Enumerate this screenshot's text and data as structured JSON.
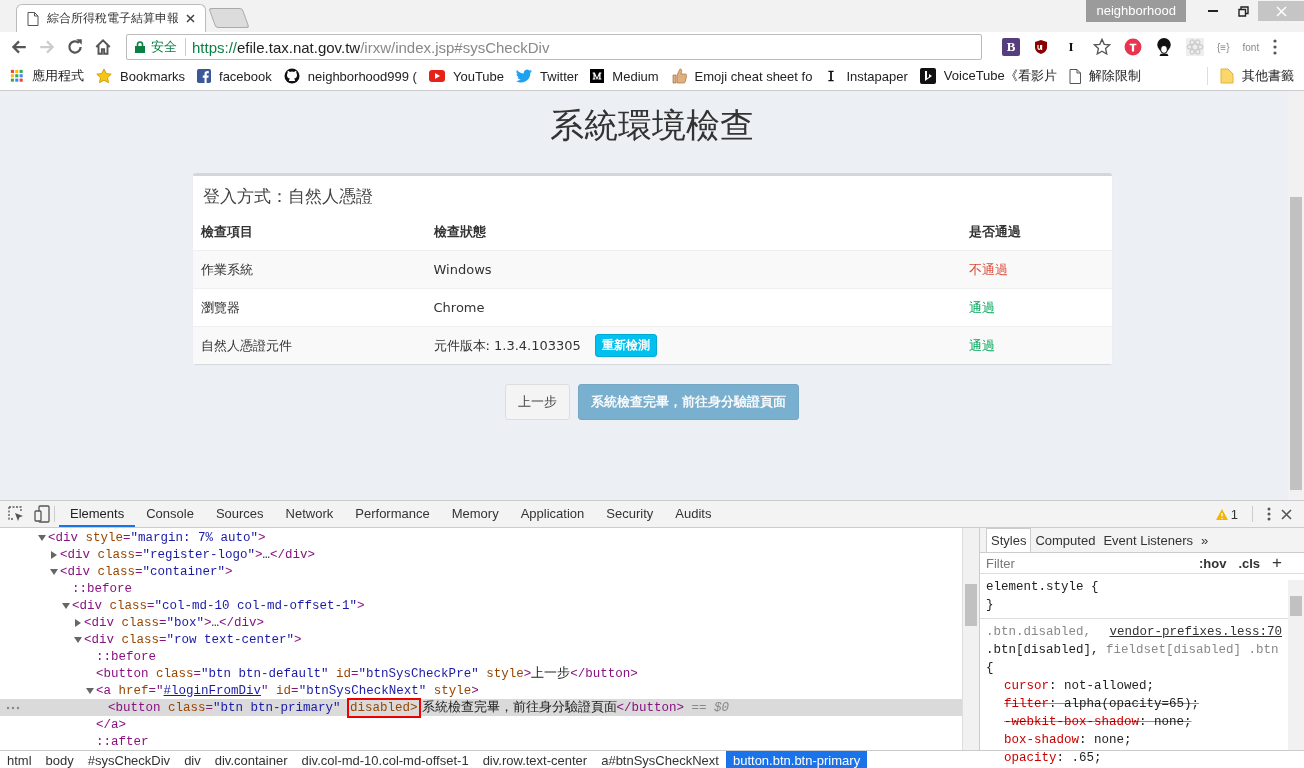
{
  "browser": {
    "tabs": [
      {
        "title": "綜合所得稅電子結算申報",
        "selected": true
      }
    ],
    "profile": "neighborhood",
    "nav_buttons": [
      {
        "kind": "back",
        "disabled": false
      },
      {
        "kind": "forward",
        "disabled": true
      },
      {
        "kind": "reload",
        "disabled": false
      },
      {
        "kind": "home",
        "disabled": false
      }
    ],
    "address": {
      "security_label": "安全",
      "url_scheme": "https://",
      "url_host": "efile.tax.nat.gov.tw",
      "url_path": "/irxw/index.jsp#sysCheckDiv"
    },
    "extensions": [
      {
        "kind": "letter",
        "label": "B",
        "color": "#563d7c"
      },
      {
        "kind": "shield"
      },
      {
        "kind": "letter",
        "label": "I",
        "color": "#ffffff"
      },
      {
        "kind": "star"
      },
      {
        "kind": "red-circle"
      },
      {
        "kind": "afro"
      },
      {
        "kind": "atom"
      },
      {
        "kind": "text",
        "label": "{≡}"
      },
      {
        "kind": "text",
        "label": "font"
      },
      {
        "kind": "menu"
      }
    ],
    "bookmarks": [
      {
        "kind": "apps",
        "label": "應用程式"
      },
      {
        "kind": "star",
        "label": "Bookmarks"
      },
      {
        "kind": "facebook",
        "label": "facebook"
      },
      {
        "kind": "github",
        "label": "neighborhood999 ("
      },
      {
        "kind": "youtube",
        "label": "YouTube"
      },
      {
        "kind": "twitter",
        "label": "Twitter"
      },
      {
        "kind": "medium",
        "label": "Medium"
      },
      {
        "kind": "thumb",
        "label": "Emoji cheat sheet fo"
      },
      {
        "kind": "letter-i",
        "label": "Instapaper"
      },
      {
        "kind": "voicetube",
        "label": "VoiceTube《看影片"
      },
      {
        "kind": "page",
        "label": "解除限制"
      }
    ],
    "other_bookmarks": "其他書籤"
  },
  "page": {
    "title": "系統環境檢查",
    "card_title": "登入方式：自然人憑證",
    "columns": [
      "檢查項目",
      "檢查狀態",
      "是否通過"
    ],
    "rows": [
      {
        "item": "作業系統",
        "status": "Windows",
        "result": "不通過",
        "passed": false
      },
      {
        "item": "瀏覽器",
        "status": "Chrome",
        "result": "通過",
        "passed": true
      },
      {
        "item": "自然人憑證元件",
        "status": "元件版本: 1.3.4.103305",
        "action": "重新檢測",
        "result": "通過",
        "passed": true
      }
    ],
    "buttons": [
      {
        "label": "上一步",
        "kind": "default",
        "disabled": false
      },
      {
        "label": "系統檢查完畢，前往身分驗證頁面",
        "kind": "primary",
        "disabled": true
      }
    ]
  },
  "devtools": {
    "tabs": [
      {
        "label": "Elements",
        "selected": true
      },
      {
        "label": "Console",
        "selected": false
      },
      {
        "label": "Sources",
        "selected": false
      },
      {
        "label": "Network",
        "selected": false
      },
      {
        "label": "Performance",
        "selected": false
      },
      {
        "label": "Memory",
        "selected": false
      },
      {
        "label": "Application",
        "selected": false
      },
      {
        "label": "Security",
        "selected": false
      },
      {
        "label": "Audits",
        "selected": false
      }
    ],
    "warning_count": "1",
    "dom_tree": [
      {
        "selected": false,
        "expanded": true,
        "segments": [
          {
            "kind": "tag",
            "text": "<div "
          },
          {
            "kind": "attr",
            "text": "style"
          },
          {
            "kind": "tag",
            "text": "="
          },
          {
            "kind": "value",
            "text": "\"margin: 7% auto\""
          },
          {
            "kind": "tag",
            "text": ">"
          }
        ],
        "children": [
          {
            "selected": false,
            "expanded": false,
            "segments": [
              {
                "kind": "tag",
                "text": "<div "
              },
              {
                "kind": "attr",
                "text": "class"
              },
              {
                "kind": "tag",
                "text": "="
              },
              {
                "kind": "value",
                "text": "\"register-logo\""
              },
              {
                "kind": "tag",
                "text": ">"
              },
              {
                "kind": "text",
                "text": "…"
              },
              {
                "kind": "tag",
                "text": "</div>"
              }
            ]
          },
          {
            "selected": false,
            "expanded": true,
            "segments": [
              {
                "kind": "tag",
                "text": "<div "
              },
              {
                "kind": "attr",
                "text": "class"
              },
              {
                "kind": "tag",
                "text": "="
              },
              {
                "kind": "value",
                "text": "\"container\""
              },
              {
                "kind": "tag",
                "text": ">"
              }
            ],
            "children": [
              {
                "selected": false,
                "segments": [
                  {
                    "kind": "pseudo",
                    "text": "::before"
                  }
                ]
              },
              {
                "selected": false,
                "expanded": true,
                "segments": [
                  {
                    "kind": "tag",
                    "text": "<div "
                  },
                  {
                    "kind": "attr",
                    "text": "class"
                  },
                  {
                    "kind": "tag",
                    "text": "="
                  },
                  {
                    "kind": "value",
                    "text": "\"col-md-10 col-md-offset-1\""
                  },
                  {
                    "kind": "tag",
                    "text": ">"
                  }
                ],
                "children": [
                  {
                    "selected": false,
                    "expanded": false,
                    "segments": [
                      {
                        "kind": "tag",
                        "text": "<div "
                      },
                      {
                        "kind": "attr",
                        "text": "class"
                      },
                      {
                        "kind": "tag",
                        "text": "="
                      },
                      {
                        "kind": "value",
                        "text": "\"box\""
                      },
                      {
                        "kind": "tag",
                        "text": ">"
                      },
                      {
                        "kind": "text",
                        "text": "…"
                      },
                      {
                        "kind": "tag",
                        "text": "</div>"
                      }
                    ]
                  },
                  {
                    "selected": false,
                    "expanded": true,
                    "segments": [
                      {
                        "kind": "tag",
                        "text": "<div "
                      },
                      {
                        "kind": "attr",
                        "text": "class"
                      },
                      {
                        "kind": "tag",
                        "text": "="
                      },
                      {
                        "kind": "value",
                        "text": "\"row text-center\""
                      },
                      {
                        "kind": "tag",
                        "text": ">"
                      }
                    ],
                    "children": [
                      {
                        "selected": false,
                        "segments": [
                          {
                            "kind": "pseudo",
                            "text": "::before"
                          }
                        ]
                      },
                      {
                        "selected": false,
                        "segments": [
                          {
                            "kind": "tag",
                            "text": "<button "
                          },
                          {
                            "kind": "attr",
                            "text": "class"
                          },
                          {
                            "kind": "tag",
                            "text": "="
                          },
                          {
                            "kind": "value",
                            "text": "\"btn btn-default\""
                          },
                          {
                            "kind": "attr",
                            "text": " id"
                          },
                          {
                            "kind": "tag",
                            "text": "="
                          },
                          {
                            "kind": "value",
                            "text": "\"btnSysCheckPre\""
                          },
                          {
                            "kind": "attr",
                            "text": " style"
                          },
                          {
                            "kind": "tag",
                            "text": ">"
                          },
                          {
                            "kind": "text",
                            "text": "上一步"
                          },
                          {
                            "kind": "tag",
                            "text": "</button>"
                          }
                        ]
                      },
                      {
                        "selected": false,
                        "expanded": true,
                        "segments": [
                          {
                            "kind": "tag",
                            "text": "<a "
                          },
                          {
                            "kind": "attr",
                            "text": "href"
                          },
                          {
                            "kind": "tag",
                            "text": "=\""
                          },
                          {
                            "kind": "link",
                            "text": "#loginFromDiv"
                          },
                          {
                            "kind": "tag",
                            "text": "\""
                          },
                          {
                            "kind": "attr",
                            "text": " id"
                          },
                          {
                            "kind": "tag",
                            "text": "="
                          },
                          {
                            "kind": "value",
                            "text": "\"btnSysCheckNext\""
                          },
                          {
                            "kind": "attr",
                            "text": " style"
                          },
                          {
                            "kind": "tag",
                            "text": ">"
                          }
                        ],
                        "children": [
                          {
                            "selected": true,
                            "segments": [
                              {
                                "kind": "tag",
                                "text": "<button "
                              },
                              {
                                "kind": "attr",
                                "text": "class"
                              },
                              {
                                "kind": "tag",
                                "text": "="
                              },
                              {
                                "kind": "value",
                                "text": "\"btn btn-primary\" "
                              },
                              {
                                "kind": "attr",
                                "text": "disabled>",
                                "boxed": true
                              },
                              {
                                "kind": "text",
                                "text": "系統檢查完畢，前往身分驗證頁面"
                              },
                              {
                                "kind": "tag",
                                "text": "</button>"
                              },
                              {
                                "kind": "eq",
                                "text": " == $0"
                              }
                            ]
                          }
                        ]
                      },
                      {
                        "selected": false,
                        "segments": [
                          {
                            "kind": "tag",
                            "text": "</a>"
                          }
                        ]
                      },
                      {
                        "selected": false,
                        "segments": [
                          {
                            "kind": "pseudo",
                            "text": "::after"
                          }
                        ]
                      }
                    ]
                  }
                ]
              }
            ]
          }
        ]
      }
    ],
    "breadcrumbs": [
      {
        "label": "html",
        "selected": false
      },
      {
        "label": "body",
        "selected": false
      },
      {
        "label": "#sysCheckDiv",
        "selected": false
      },
      {
        "label": "div",
        "selected": false
      },
      {
        "label": "div.container",
        "selected": false
      },
      {
        "label": "div.col-md-10.col-md-offset-1",
        "selected": false
      },
      {
        "label": "div.row.text-center",
        "selected": false
      },
      {
        "label": "a#btnSysCheckNext",
        "selected": false
      },
      {
        "label": "button.btn.btn-primary",
        "selected": true
      }
    ],
    "side_tabs": [
      {
        "label": "Styles",
        "selected": true
      },
      {
        "label": "Computed",
        "selected": false
      },
      {
        "label": "Event Listeners",
        "selected": false
      }
    ],
    "side_more": "»",
    "filter": {
      "placeholder": "Filter",
      "hov": ":hov",
      "cls": ".cls",
      "add": "+"
    },
    "style_rules": [
      {
        "lines": [
          {
            "kind": "selector",
            "segments": [
              {
                "kind": "sel",
                "text": "element.style {"
              }
            ]
          },
          {
            "kind": "selector",
            "segments": [
              {
                "kind": "sel",
                "text": "}"
              }
            ]
          }
        ]
      },
      {
        "lines": [
          {
            "kind": "selector",
            "segments": [
              {
                "kind": "dim",
                "text": ".btn.disabled,"
              },
              {
                "kind": "source",
                "text": "vendor-prefixes.less:70"
              }
            ]
          },
          {
            "kind": "selector",
            "segments": [
              {
                "kind": "sel",
                "text": ".btn[disabled], "
              },
              {
                "kind": "dim",
                "text": "fieldset[disabled] .btn"
              }
            ]
          },
          {
            "kind": "selector",
            "segments": [
              {
                "kind": "sel",
                "text": "{"
              }
            ]
          },
          {
            "kind": "property",
            "overridden": false,
            "segments": [
              {
                "kind": "prop",
                "text": "cursor"
              },
              {
                "kind": "sel",
                "text": ": not-allowed;"
              }
            ]
          },
          {
            "kind": "property",
            "overridden": true,
            "segments": [
              {
                "kind": "prop",
                "text": "filter"
              },
              {
                "kind": "sel",
                "text": ": alpha(opacity=65);"
              }
            ]
          },
          {
            "kind": "property",
            "overridden": true,
            "segments": [
              {
                "kind": "prop",
                "text": "-webkit-box-shadow"
              },
              {
                "kind": "sel",
                "text": ": none;"
              }
            ]
          },
          {
            "kind": "property",
            "overridden": false,
            "segments": [
              {
                "kind": "prop",
                "text": "box-shadow"
              },
              {
                "kind": "sel",
                "text": ": none;"
              }
            ]
          },
          {
            "kind": "property",
            "overridden": false,
            "segments": [
              {
                "kind": "prop",
                "text": "opacity"
              },
              {
                "kind": "sel",
                "text": ": .65;"
              }
            ]
          }
        ]
      }
    ]
  }
}
